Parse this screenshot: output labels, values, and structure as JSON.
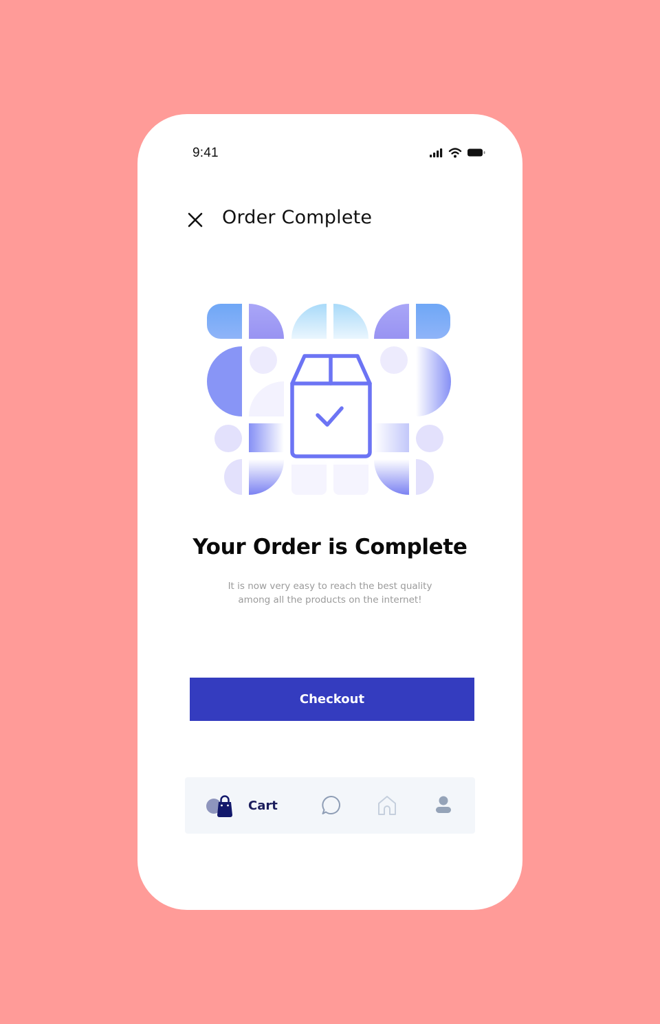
{
  "status_bar": {
    "time": "9:41"
  },
  "header": {
    "title": "Order Complete"
  },
  "content": {
    "headline": "Your Order is Complete",
    "description": "It is now very easy to reach the best quality among all the products on the internet!"
  },
  "actions": {
    "checkout_label": "Checkout"
  },
  "bottom_nav": {
    "items": [
      {
        "label": "Cart",
        "icon": "shopping-bag-icon",
        "active": true
      },
      {
        "label": "",
        "icon": "chat-icon",
        "active": false
      },
      {
        "label": "",
        "icon": "home-icon",
        "active": false
      },
      {
        "label": "",
        "icon": "profile-icon",
        "active": false
      }
    ]
  },
  "colors": {
    "background": "#FF9B98",
    "primary": "#343CBF",
    "illustration_accent": "#6C74F4",
    "nav_active": "#1B1D5C"
  }
}
